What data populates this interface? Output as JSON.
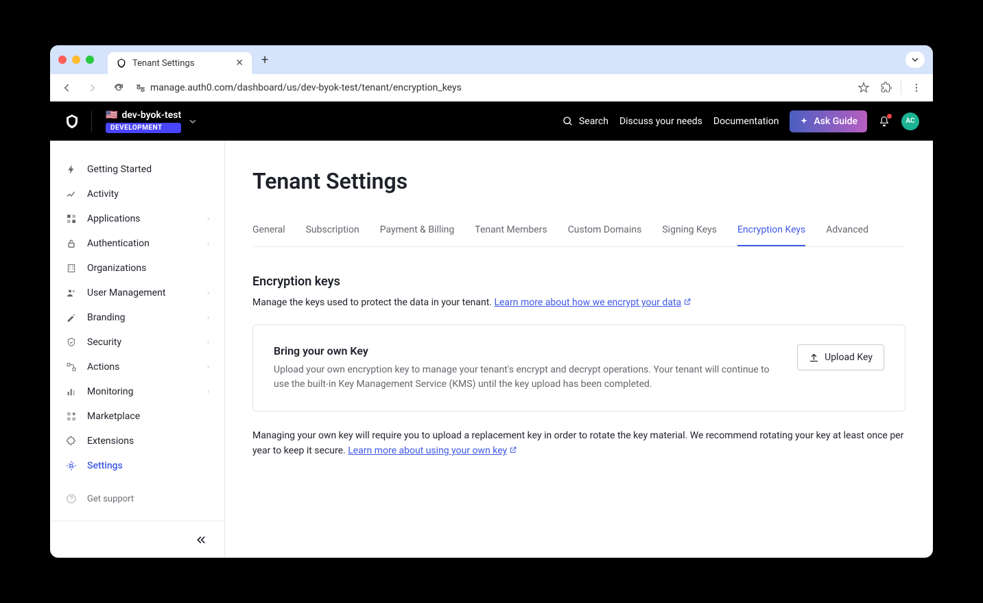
{
  "browser": {
    "tab_title": "Tenant Settings",
    "url": "manage.auth0.com/dashboard/us/dev-byok-test/tenant/encryption_keys"
  },
  "header": {
    "tenant_name": "dev-byok-test",
    "tenant_badge": "DEVELOPMENT",
    "search": "Search",
    "discuss": "Discuss your needs",
    "docs": "Documentation",
    "ask_guide": "Ask Guide",
    "avatar": "AC"
  },
  "sidebar": {
    "items": [
      {
        "label": "Getting Started",
        "expandable": false
      },
      {
        "label": "Activity",
        "expandable": false
      },
      {
        "label": "Applications",
        "expandable": true
      },
      {
        "label": "Authentication",
        "expandable": true
      },
      {
        "label": "Organizations",
        "expandable": false
      },
      {
        "label": "User Management",
        "expandable": true
      },
      {
        "label": "Branding",
        "expandable": true
      },
      {
        "label": "Security",
        "expandable": true
      },
      {
        "label": "Actions",
        "expandable": true
      },
      {
        "label": "Monitoring",
        "expandable": true
      },
      {
        "label": "Marketplace",
        "expandable": false
      },
      {
        "label": "Extensions",
        "expandable": false
      },
      {
        "label": "Settings",
        "expandable": false
      }
    ],
    "support": "Get support"
  },
  "main": {
    "page_title": "Tenant Settings",
    "tabs": [
      "General",
      "Subscription",
      "Payment & Billing",
      "Tenant Members",
      "Custom Domains",
      "Signing Keys",
      "Encryption Keys",
      "Advanced"
    ],
    "active_tab": "Encryption Keys",
    "section": {
      "title": "Encryption keys",
      "desc_pre": "Manage the keys used to protect the data in your tenant. ",
      "desc_link": "Learn more about how we encrypt your data"
    },
    "card": {
      "title": "Bring your own Key",
      "desc": "Upload your own encryption key to manage your tenant's encrypt and decrypt operations. Your tenant will continue to use the built-in Key Management Service (KMS) until the key upload has been completed.",
      "button": "Upload Key"
    },
    "footnote": {
      "pre": "Managing your own key will require you to upload a replacement key in order to rotate the key material. We recommend rotating your key at least once per year to keep it secure. ",
      "link": "Learn more about using your own key"
    }
  }
}
